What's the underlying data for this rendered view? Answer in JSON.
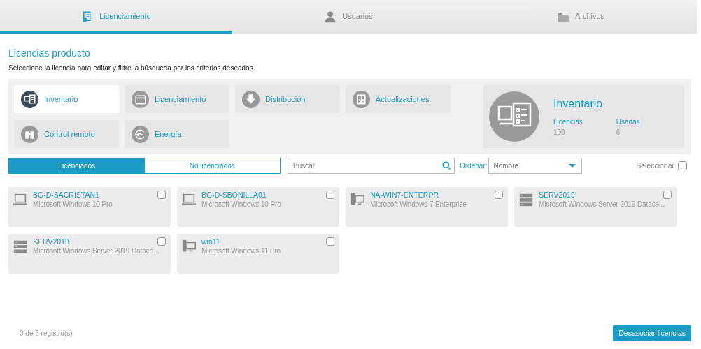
{
  "tabs": [
    {
      "label": "Licenciamiento",
      "selected": true
    },
    {
      "label": "Usuarios",
      "selected": false
    },
    {
      "label": "Archivos",
      "selected": false
    }
  ],
  "heading": "Licencias producto",
  "subtitle": "Seleccione la licencia para editar y filtre la búsqueda por los criterios deseados",
  "modules": [
    {
      "label": "Inventario",
      "selected": true
    },
    {
      "label": "Licenciamiento",
      "selected": false
    },
    {
      "label": "Distribución",
      "selected": false
    },
    {
      "label": "Actualizaciones",
      "selected": false
    },
    {
      "label": "Control remoto",
      "selected": false
    },
    {
      "label": "Energía",
      "selected": false
    }
  ],
  "summary": {
    "title": "Inventario",
    "stats": [
      {
        "label": "Licencias",
        "value": "100"
      },
      {
        "label": "Usadas",
        "value": "6"
      }
    ]
  },
  "filter_toggle": [
    {
      "label": "Licenciados",
      "selected": true
    },
    {
      "label": "No licenciados",
      "selected": false
    }
  ],
  "search": {
    "placeholder": "Buscar"
  },
  "sort": {
    "label": "Ordenar:",
    "value": "Nombre"
  },
  "select_all": {
    "label": "Seleccionar",
    "checked": false
  },
  "devices": [
    {
      "kind": "laptop",
      "name": "BG-D-SACRISTAN1",
      "os": "Microsoft Windows 10 Pro",
      "checked": false
    },
    {
      "kind": "laptop",
      "name": "BG-D-SBONILLA01",
      "os": "Microsoft Windows 10 Pro",
      "checked": false
    },
    {
      "kind": "desktop",
      "name": "NA-WIN7-ENTERPR",
      "os": "Microsoft Windows 7 Enterprise",
      "checked": false
    },
    {
      "kind": "server",
      "name": "SERV2019",
      "os": "Microsoft Windows Server 2019 Datace...",
      "checked": false
    },
    {
      "kind": "server",
      "name": "SERV2019",
      "os": "Microsoft Windows Server 2019 Datace...",
      "checked": false
    },
    {
      "kind": "desktop",
      "name": "win11",
      "os": "Microsoft Windows 11 Pro",
      "checked": false
    }
  ],
  "footer": {
    "count": "0 de 6 registro(s)",
    "button": "Desasociar licencias"
  }
}
